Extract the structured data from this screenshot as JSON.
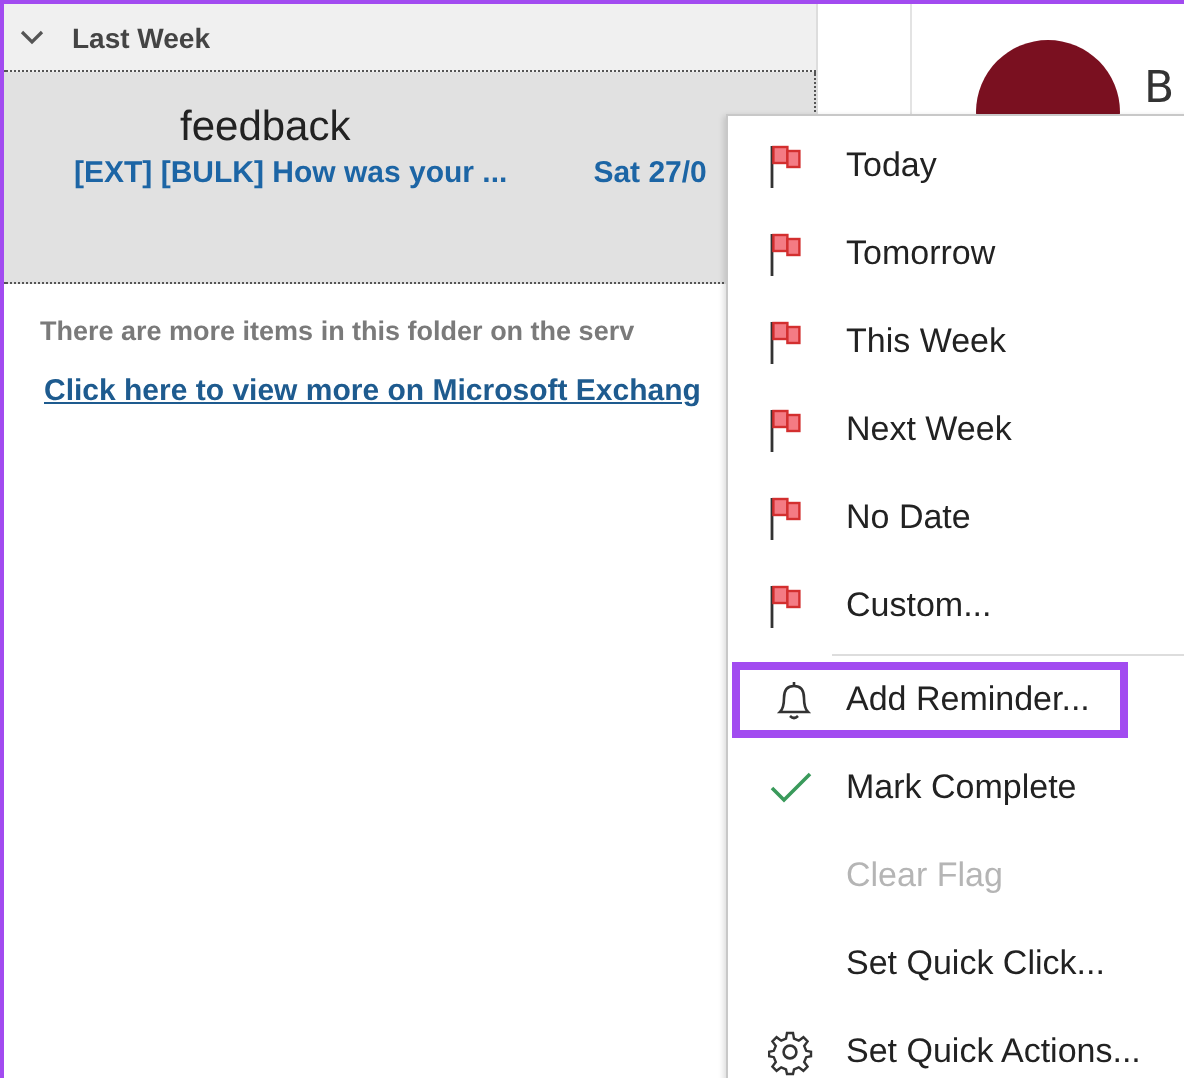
{
  "mail_list": {
    "group": {
      "label": "Last Week",
      "expanded": true
    },
    "messages": [
      {
        "sender": "feedback",
        "subject": "[EXT] [BULK] How was your ...",
        "date": "Sat 27/0",
        "selected": true
      }
    ],
    "server_notice": "There are more items in this folder on the serv",
    "server_link": "Click here to view more on Microsoft Exchang"
  },
  "reading_pane": {
    "sender": "B"
  },
  "context_menu": {
    "items": [
      {
        "kind": "flag",
        "label": "Today",
        "disabled": false,
        "highlighted": false
      },
      {
        "kind": "flag",
        "label": "Tomorrow",
        "disabled": false,
        "highlighted": false
      },
      {
        "kind": "flag",
        "label": "This Week",
        "disabled": false,
        "highlighted": false
      },
      {
        "kind": "flag",
        "label": "Next Week",
        "disabled": false,
        "highlighted": false
      },
      {
        "kind": "flag",
        "label": "No Date",
        "disabled": false,
        "highlighted": false
      },
      {
        "kind": "flag",
        "label": "Custom...",
        "disabled": false,
        "highlighted": false
      },
      {
        "kind": "separator"
      },
      {
        "kind": "bell",
        "label": "Add Reminder...",
        "disabled": false,
        "highlighted": true
      },
      {
        "kind": "check",
        "label": "Mark Complete",
        "disabled": false,
        "highlighted": false
      },
      {
        "kind": "plain",
        "label": "Clear Flag",
        "disabled": true,
        "highlighted": false
      },
      {
        "kind": "plain",
        "label": "Set Quick Click...",
        "disabled": false,
        "highlighted": false
      },
      {
        "kind": "gear",
        "label": "Set Quick Actions...",
        "disabled": false,
        "highlighted": false
      }
    ]
  }
}
